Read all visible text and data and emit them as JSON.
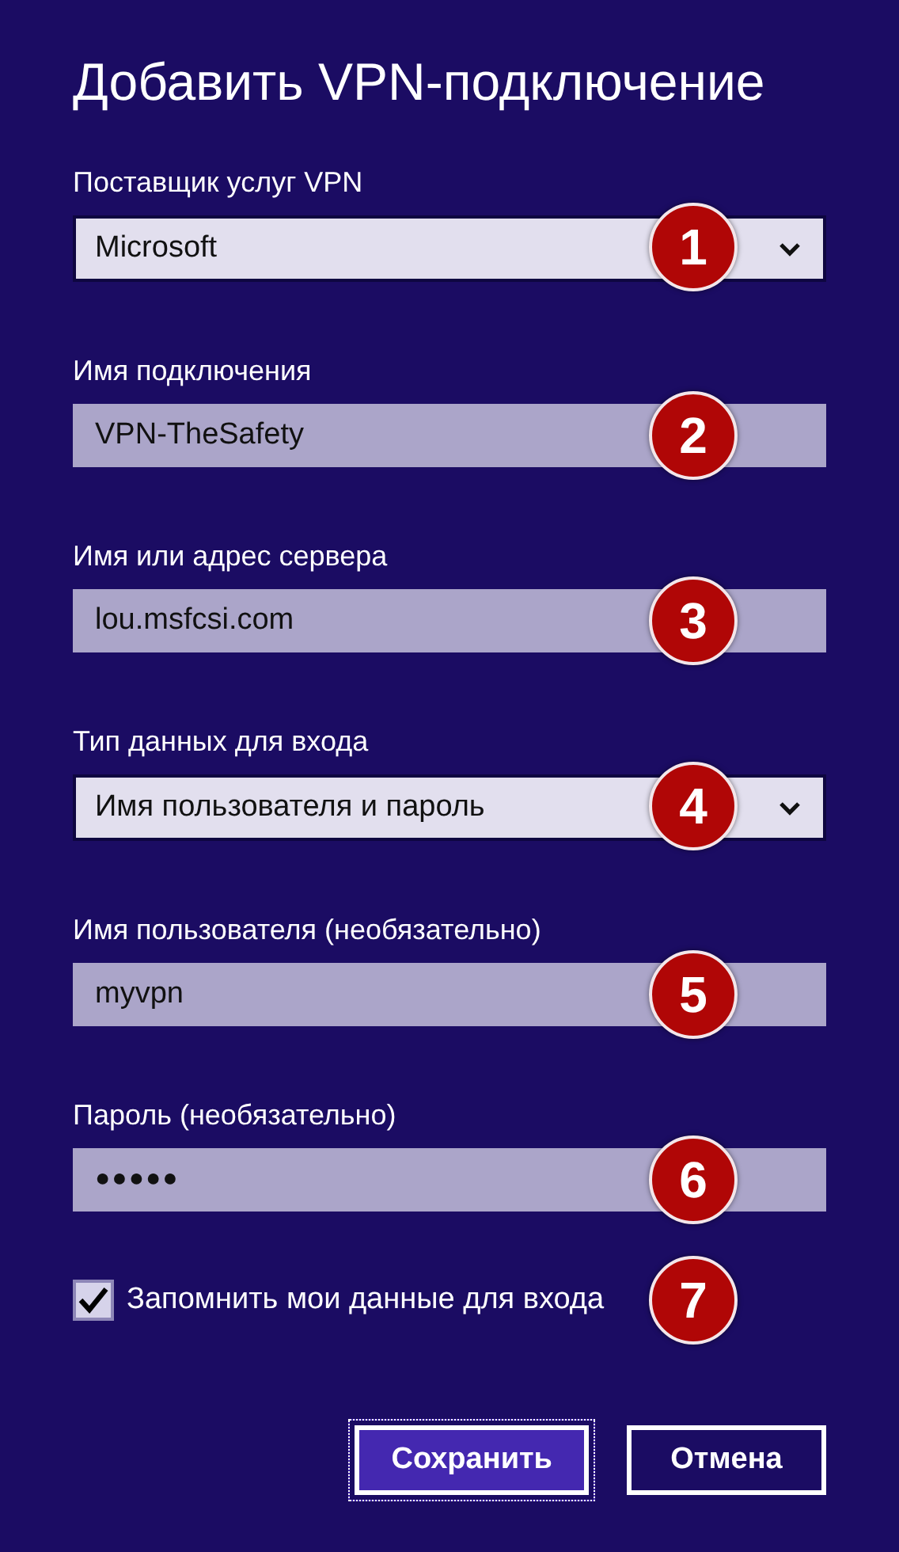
{
  "title": "Добавить VPN-подключение",
  "fields": [
    {
      "kind": "dropdown",
      "label": "Поставщик услуг VPN",
      "value": "Microsoft",
      "badge": "1"
    },
    {
      "kind": "text",
      "label": "Имя подключения",
      "value": "VPN-TheSafety",
      "badge": "2"
    },
    {
      "kind": "text",
      "label": "Имя или адрес сервера",
      "value": "lou.msfcsi.com",
      "badge": "3"
    },
    {
      "kind": "dropdown",
      "label": "Тип данных для входа",
      "value": "Имя пользователя и пароль",
      "badge": "4"
    },
    {
      "kind": "text",
      "label": "Имя пользователя (необязательно)",
      "value": "myvpn",
      "badge": "5"
    },
    {
      "kind": "password",
      "label": "Пароль (необязательно)",
      "value": "●●●●●",
      "badge": "6"
    }
  ],
  "remember": {
    "label": "Запомнить мои данные для входа",
    "checked": true,
    "badge": "7"
  },
  "buttons": [
    {
      "label": "Сохранить",
      "kind": "primary",
      "focused": true
    },
    {
      "label": "Отмена",
      "kind": "secondary",
      "focused": false
    }
  ]
}
